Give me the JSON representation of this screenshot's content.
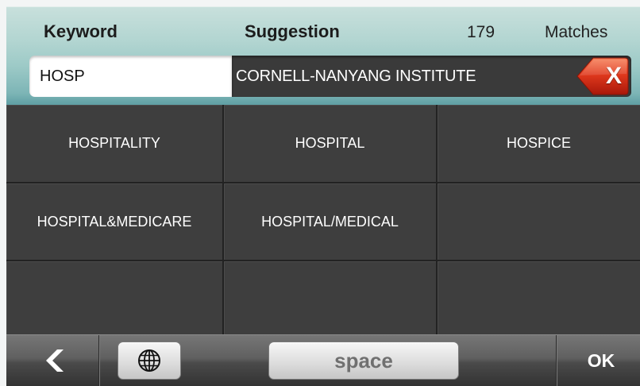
{
  "header": {
    "keyword_label": "Keyword",
    "suggestion_label": "Suggestion",
    "match_count": "179",
    "matches_label": "Matches"
  },
  "search": {
    "keyword_value": "HOSP",
    "suggestion_value": "CORNELL-NANYANG INSTITUTE",
    "clear_label": "X",
    "clear_icon": "backspace-icon"
  },
  "results": {
    "rows": [
      [
        "HOSPITALITY",
        "HOSPITAL",
        "HOSPICE"
      ],
      [
        "HOSPITAL&MEDICARE",
        "HOSPITAL/MEDICAL",
        ""
      ],
      [
        "",
        "",
        ""
      ]
    ]
  },
  "toolbar": {
    "back_icon": "chevron-left-icon",
    "language_icon": "globe-icon",
    "space_label": "space",
    "ok_label": "OK"
  },
  "colors": {
    "header_light": "#c8e0dc",
    "header_dark": "#5f9fa4",
    "suggestion_bar": "#3a3a3a",
    "cell": "#3e3e3e",
    "cell_divider": "#222222",
    "clear_button": "#e0391d",
    "toolbar": "#4a4a4a"
  }
}
